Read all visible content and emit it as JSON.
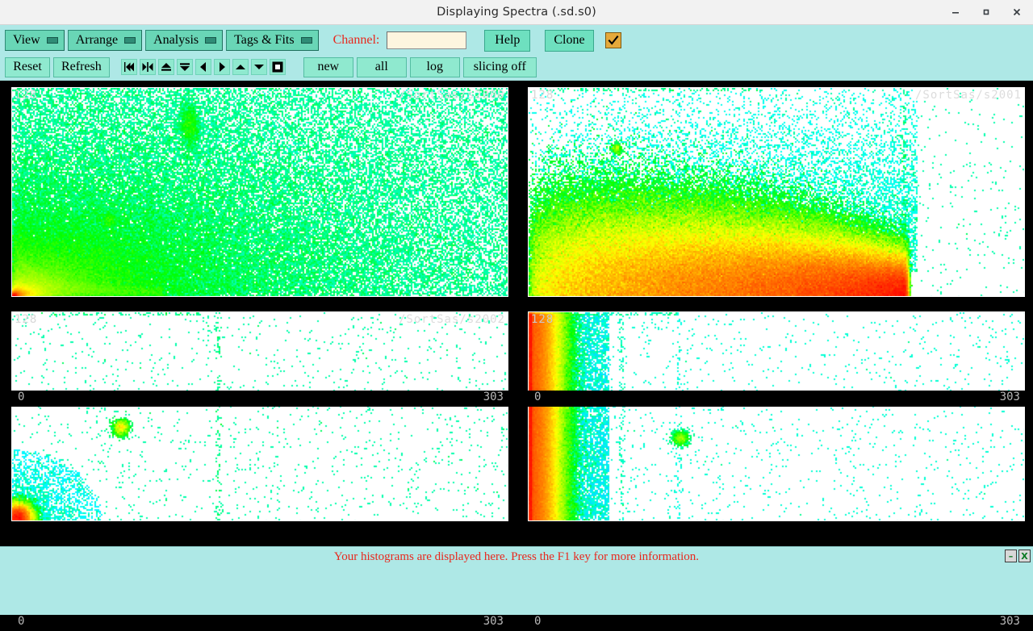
{
  "window": {
    "title": "Displaying Spectra (.sd.s0)",
    "minimize_label": "minimize",
    "maximize_label": "maximize",
    "close_label": "close"
  },
  "toolbar": {
    "menus": [
      {
        "label": "View"
      },
      {
        "label": "Arrange"
      },
      {
        "label": "Analysis"
      },
      {
        "label": "Tags & Fits"
      }
    ],
    "channel_label": "Channel:",
    "channel_value": "",
    "channel_placeholder": "",
    "help_label": "Help",
    "clone_label": "Clone",
    "checkbox_checked": true,
    "checkbox_name": "confirm-checkbox",
    "reset_label": "Reset",
    "refresh_label": "Refresh",
    "nav_icons": [
      {
        "name": "jump-first-icon",
        "glyph": "first"
      },
      {
        "name": "expand-horizontal-icon",
        "glyph": "expand-h"
      },
      {
        "name": "collapse-up-icon",
        "glyph": "up-bar"
      },
      {
        "name": "collapse-down-icon",
        "glyph": "down-bar"
      },
      {
        "name": "step-left-icon",
        "glyph": "left"
      },
      {
        "name": "step-right-icon",
        "glyph": "right"
      },
      {
        "name": "scroll-up-icon",
        "glyph": "up"
      },
      {
        "name": "scroll-down-icon",
        "glyph": "down"
      },
      {
        "name": "stop-square-icon",
        "glyph": "square"
      }
    ],
    "mode_buttons": [
      {
        "label": "new"
      },
      {
        "label": "all"
      },
      {
        "label": "log"
      },
      {
        "label": "slicing off"
      }
    ]
  },
  "panels": [
    {
      "spectrum": "/SortSas/s2000",
      "ymax": "128",
      "ymin": "0",
      "xmin": "0",
      "xmax": "303"
    },
    {
      "spectrum": "/SortSas/s2001",
      "ymax": "128",
      "ymin": "0",
      "xmin": "0",
      "xmax": "303"
    },
    {
      "spectrum": "/SortSas/s2002",
      "ymax": "128",
      "ymin": "0",
      "xmin": "0",
      "xmax": "303"
    },
    {
      "spectrum": "",
      "ymax": "128",
      "ymin": "0",
      "xmin": "0",
      "xmax": "303"
    }
  ],
  "statusbar": {
    "message": "Your histograms are displayed here. Press the F1 key for more information.",
    "min_label": "–",
    "close_label": "X"
  },
  "colors": {
    "toolbar_bg": "#aee8e6",
    "menu_button": "#69d6b6",
    "plain_button": "#6ee0bf",
    "secondary_button": "#8fe9cf",
    "checkbox_bg": "#e5a93a",
    "channel_label": "#e8281e",
    "status_text": "#e8281e",
    "plot_bg": "#000000",
    "canvas_bg": "#ffffff",
    "axis_text": "#b9b9b9",
    "data_low": "#0000ff",
    "data_mid": "#00ff00",
    "data_high": "#ff0000"
  },
  "chart_data": [
    {
      "type": "heatmap",
      "title": "/SortSas/s2000",
      "xlabel": "",
      "ylabel": "",
      "xlim": [
        0,
        303
      ],
      "ylim": [
        0,
        128
      ],
      "grid": false,
      "colormap": "rainbow (blue=low, green=mid, red=high)",
      "description": "Hyperbolic banana distribution decaying from the lower-left origin corner, plus an isolated dense cluster near (110,105) and a small cluster near (60,45)",
      "features": [
        {
          "kind": "ridge",
          "x": 4,
          "y": 4,
          "intensity": "high"
        },
        {
          "kind": "cluster",
          "x": 108,
          "y": 106,
          "intensity": "medium"
        },
        {
          "kind": "cluster",
          "x": 58,
          "y": 44,
          "intensity": "low"
        }
      ]
    },
    {
      "type": "heatmap",
      "title": "/SortSas/s2001",
      "xlabel": "",
      "ylabel": "",
      "xlim": [
        0,
        303
      ],
      "ylim": [
        0,
        128
      ],
      "grid": false,
      "colormap": "rainbow (blue=low, green=mid, red=high)",
      "description": "Broad dense horizontal band along the bottom spanning x 0 to ~110 with a hot green/red core at the origin and a diffuse blue halo above",
      "features": [
        {
          "kind": "band",
          "x": 50,
          "y": 8,
          "intensity": "high"
        },
        {
          "kind": "cluster",
          "x": 53,
          "y": 101,
          "intensity": "low"
        }
      ]
    },
    {
      "type": "heatmap",
      "title": "/SortSas/s2002",
      "xlabel": "",
      "ylabel": "",
      "xlim": [
        0,
        303
      ],
      "ylim": [
        0,
        128
      ],
      "grid": false,
      "colormap": "rainbow (blue=low, green=mid, red=high)",
      "description": "Sparse scatter of isolated counts with a compact bright blob at the origin corner, a mid-field cluster near (65,55) and a faint vertical stripe near x=128",
      "features": [
        {
          "kind": "blob",
          "x": 4,
          "y": 4,
          "intensity": "medium"
        },
        {
          "kind": "cluster",
          "x": 66,
          "y": 56,
          "intensity": "low"
        },
        {
          "kind": "stripe",
          "x": 128,
          "y": 60,
          "intensity": "low"
        }
      ]
    },
    {
      "type": "heatmap",
      "title": "",
      "xlabel": "",
      "ylabel": "",
      "xlim": [
        0,
        303
      ],
      "ylim": [
        0,
        128
      ],
      "grid": false,
      "colormap": "rainbow (blue=low, green=mid, red=high)",
      "description": "Dense vertical band hugging the left axis over the full y range with green/red core, sparse scatter elsewhere and a cluster near (92,48)",
      "features": [
        {
          "kind": "band",
          "x": 2,
          "y": 64,
          "intensity": "high"
        },
        {
          "kind": "cluster",
          "x": 92,
          "y": 48,
          "intensity": "low"
        },
        {
          "kind": "stripe",
          "x": 54,
          "y": 60,
          "intensity": "low"
        }
      ]
    }
  ]
}
